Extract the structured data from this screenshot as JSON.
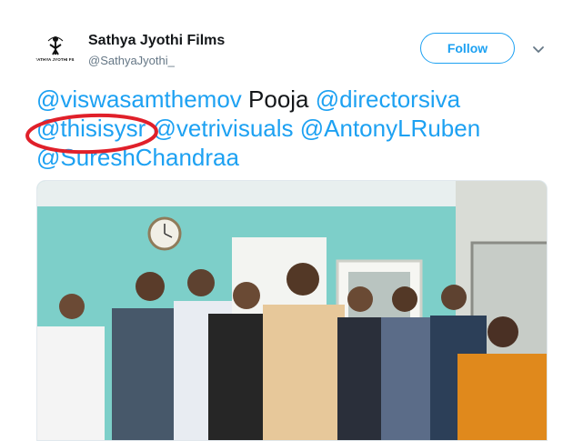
{
  "account": {
    "name": "Sathya Jyothi Films",
    "handle": "@SathyaJyothi_",
    "logo_text": "SATHYA JYOTHI FILMS"
  },
  "actions": {
    "follow_label": "Follow",
    "more_icon": "chevron-down-icon"
  },
  "tweet": {
    "mention_1": "@viswasamthemov",
    "word_1": " Pooja ",
    "mention_2": "@directorsiva",
    "mention_3": "@thisisysr",
    "space_1": " ",
    "mention_4": "@vetrivisuals",
    "space_2": " ",
    "mention_5": "@AntonyLRuben",
    "mention_6": "@SureshChandraa"
  },
  "colors": {
    "accent": "#1da1f2",
    "annotation": "#e0202a",
    "wall": "#7dcfc9"
  }
}
